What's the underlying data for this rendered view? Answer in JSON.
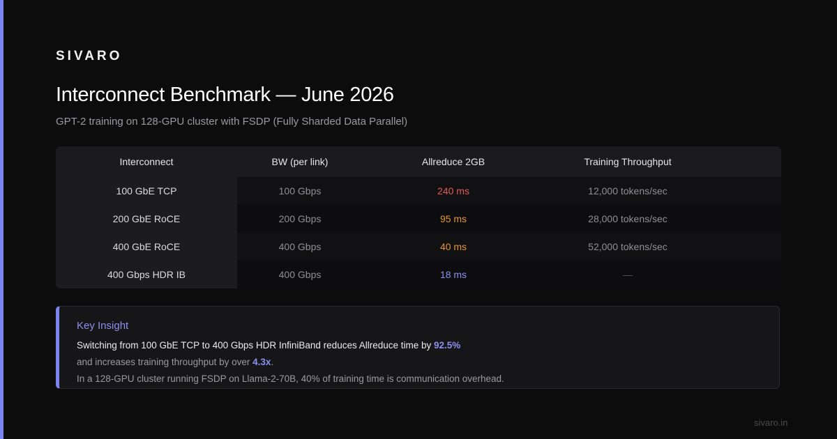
{
  "brand": "SIVARO",
  "title": "Interconnect Benchmark — June 2026",
  "subtitle": "GPT-2 training on 128-GPU cluster with FSDP (Fully Sharded Data Parallel)",
  "colors": {
    "accent": "#7b84f0",
    "slow": "#e25a55",
    "medium": "#e5952f",
    "fast": "#8b90f0"
  },
  "table": {
    "headers": [
      "Interconnect",
      "BW (per link)",
      "Allreduce 2GB",
      "Training Throughput"
    ],
    "rows": [
      [
        "100 GbE TCP",
        "100 Gbps",
        "240 ms",
        "12,000 tokens/sec"
      ],
      [
        "200 GbE RoCE",
        "200 Gbps",
        "95 ms",
        "28,000 tokens/sec"
      ],
      [
        "400 GbE RoCE",
        "400 Gbps",
        "40 ms",
        "52,000 tokens/sec"
      ],
      [
        "400 Gbps HDR IB",
        "400 Gbps",
        "18 ms",
        "—"
      ]
    ]
  },
  "insight": {
    "title": "Key Insight",
    "line1_pre": "Switching from 100 GbE TCP to 400 Gbps HDR InfiniBand reduces Allreduce time by ",
    "line1_value": "92.5%",
    "line2_pre": "and increases training throughput by over ",
    "line2_value": "4.3x",
    "line2_post": ".",
    "line3": "In a 128-GPU cluster running FSDP on Llama-2-70B, 40% of training time is communication overhead."
  },
  "footer": "sivaro.in"
}
